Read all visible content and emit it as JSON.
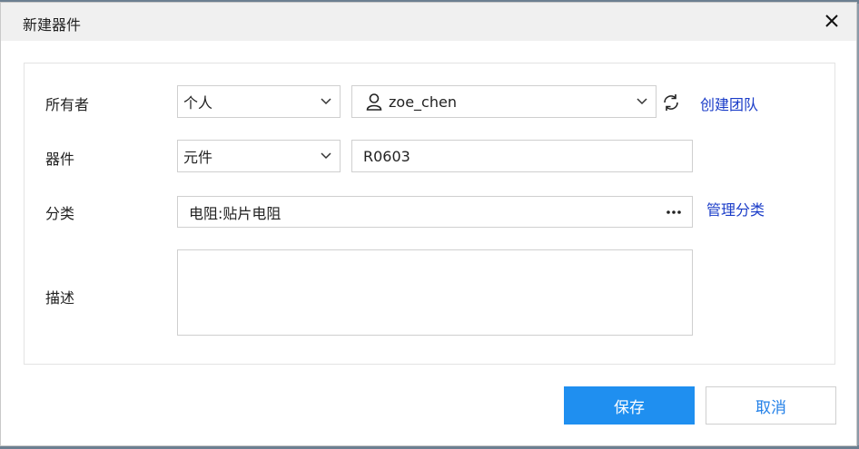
{
  "dialog": {
    "title": "新建器件"
  },
  "form": {
    "owner": {
      "label": "所有者",
      "type_value": "个人",
      "user_value": "zoe_chen",
      "create_team_link": "创建团队"
    },
    "component": {
      "label": "器件",
      "type_value": "元件",
      "name_value": "R0603"
    },
    "category": {
      "label": "分类",
      "value": "电阻:贴片电阻",
      "manage_link": "管理分类"
    },
    "description": {
      "label": "描述",
      "value": ""
    }
  },
  "footer": {
    "save_label": "保存",
    "cancel_label": "取消"
  },
  "colors": {
    "primary": "#1f8ff0",
    "link": "#1a3cc8",
    "titlebar": "#f0f0f0"
  },
  "icons": [
    "close-icon",
    "chevron-down-icon",
    "user-icon",
    "refresh-icon",
    "ellipsis-icon"
  ]
}
